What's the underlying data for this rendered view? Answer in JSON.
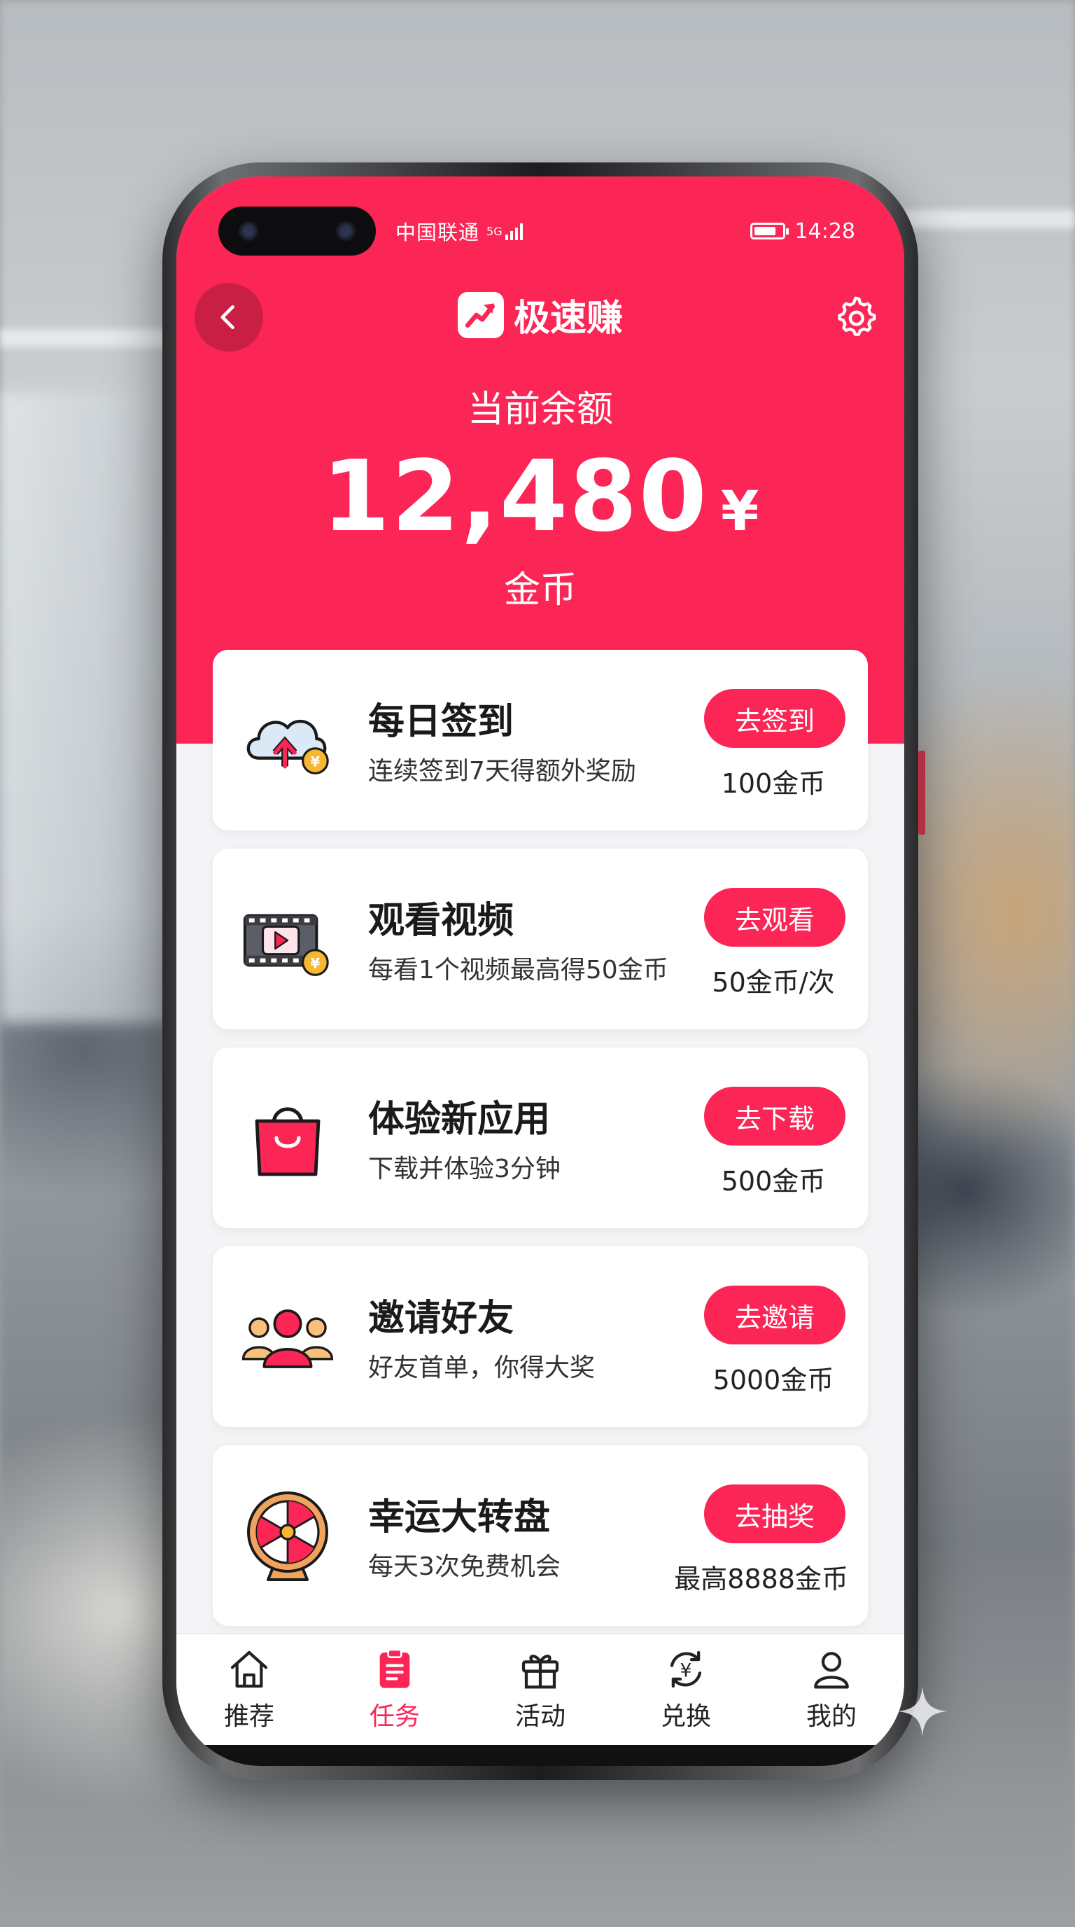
{
  "status_bar": {
    "carrier": "中国联通",
    "network": "5G",
    "time": "14:28"
  },
  "header": {
    "app_name": "极速赚",
    "balance_label": "当前余额",
    "balance_value": "12,480",
    "balance_currency": "¥",
    "balance_unit": "金币"
  },
  "tasks": [
    {
      "icon": "cloud-upload-coin-icon",
      "title": "每日签到",
      "desc": "连续签到7天得额外奖励",
      "button": "去签到",
      "reward": "100金币"
    },
    {
      "icon": "video-film-coin-icon",
      "title": "观看视频",
      "desc": "每看1个视频最高得50金币",
      "button": "去观看",
      "reward": "50金币/次"
    },
    {
      "icon": "shopping-bag-icon",
      "title": "体验新应用",
      "desc": "下载并体验3分钟",
      "button": "去下载",
      "reward": "500金币"
    },
    {
      "icon": "friends-group-icon",
      "title": "邀请好友",
      "desc": "好友首单，你得大奖",
      "button": "去邀请",
      "reward": "5000金币"
    },
    {
      "icon": "lucky-wheel-icon",
      "title": "幸运大转盘",
      "desc": "每天3次免费机会",
      "button": "去抽奖",
      "reward": "最高8888金币"
    }
  ],
  "bottom_nav": [
    {
      "icon": "home-icon",
      "label": "推荐"
    },
    {
      "icon": "task-list-icon",
      "label": "任务",
      "active": true
    },
    {
      "icon": "gift-icon",
      "label": "活动"
    },
    {
      "icon": "exchange-icon",
      "label": "兑换"
    },
    {
      "icon": "user-icon",
      "label": "我的"
    }
  ],
  "colors": {
    "brand": "#fb2556",
    "background": "#f4f4f6"
  }
}
